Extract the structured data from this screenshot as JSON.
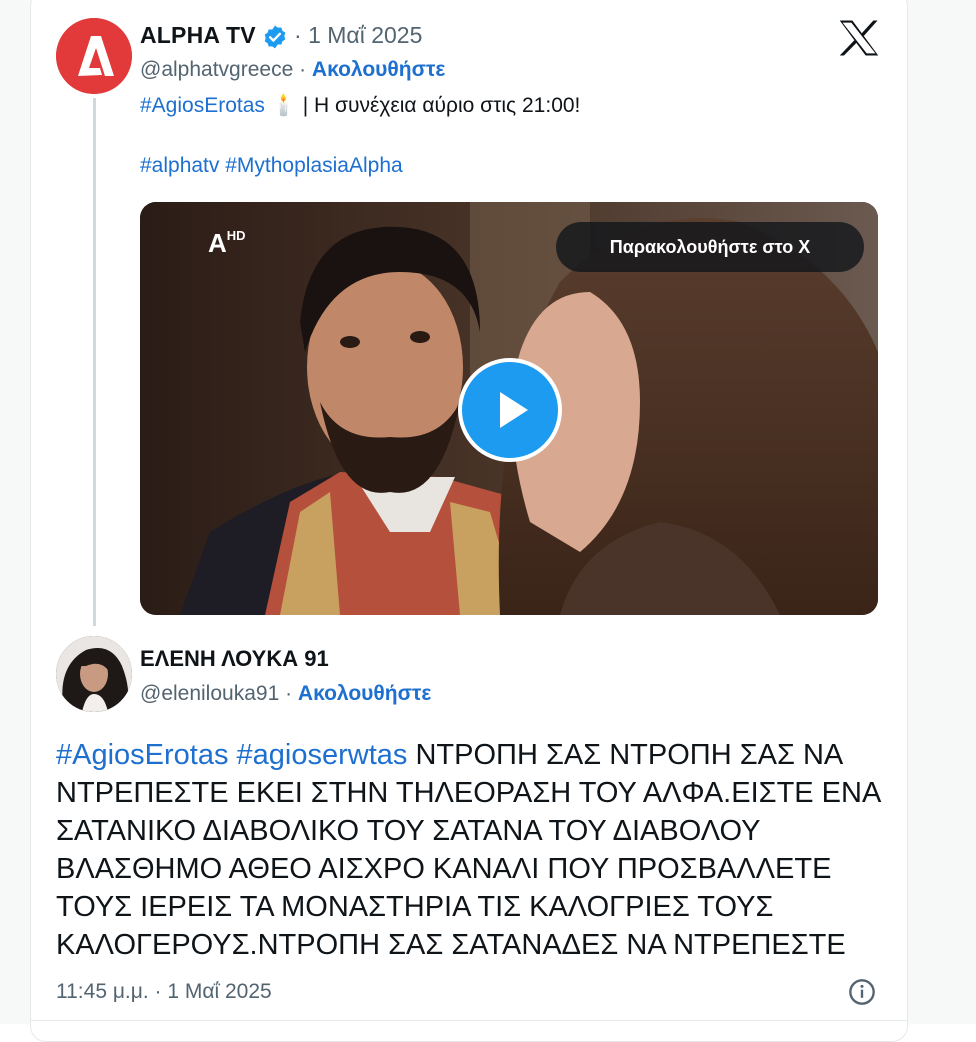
{
  "tweet": {
    "author_name": "ALPHA TV",
    "date": "1 Μαΐ 2025",
    "handle": "@alphatvgreece",
    "follow_label": "Ακολουθήστε",
    "text_hashtag": "#AgiosErotas",
    "text_emoji": "🕯️",
    "text_rest": "| Η συνέχεια αύριο στις 21:00!",
    "tags": "#alphatv #MythoplasiaAlpha",
    "watch_label": "Παρακολουθήστε στο X",
    "channel_logo": "Α",
    "channel_logo_sup": "HD"
  },
  "reply": {
    "author_name": "ΕΛΕΝΗ ΛΟΥΚΑ 91",
    "handle": "@elenilouka91",
    "follow_label": "Ακολουθήστε",
    "hashtags": "#AgiosErotas #agioserwtas",
    "body": "ΝΤΡΟΠΗ ΣΑΣ ΝΤΡΟΠΗ ΣΑΣ ΝΑ ΝΤΡΕΠΕΣΤΕ ΕΚΕΙ ΣΤΗΝ ΤΗΛΕΟΡΑΣΗ ΤΟΥ ΑΛΦΑ.ΕΙΣΤΕ ΕΝΑ ΣΑΤΑΝΙΚΟ ΔΙΑΒΟΛΙΚΟ ΤΟΥ ΣΑΤΑΝΑ ΤΟΥ ΔΙΑΒΟΛΟΥ ΒΛΑΣΘΗΜΟ ΑΘΕΟ ΑΙΣΧΡΟ ΚΑΝΑΛΙ ΠΟΥ ΠΡΟΣΒΑΛΛΕΤΕ ΤΟΥΣ ΙΕΡΕΙΣ ΤΑ ΜΟΝΑΣΤΗΡΙΑ ΤΙΣ ΚΑΛΟΓΡΙΕΣ ΤΟΥΣ ΚΑΛΟΓΕΡΟΥΣ.ΝΤΡΟΠΗ ΣΑΣ ΣΑΤΑΝΑΔΕΣ ΝΑ ΝΤΡΕΠΕΣΤΕ",
    "timestamp": "11:45 μ.μ. · 1 Μαΐ 2025"
  },
  "icons": {
    "verified": "verified-badge-icon",
    "platform": "x-logo-icon",
    "play": "play-icon",
    "info": "info-icon"
  },
  "colors": {
    "link": "#1d6fd0",
    "muted": "#536471",
    "alpha_brand": "#e23a3a",
    "play_button": "#1d9bf0"
  }
}
